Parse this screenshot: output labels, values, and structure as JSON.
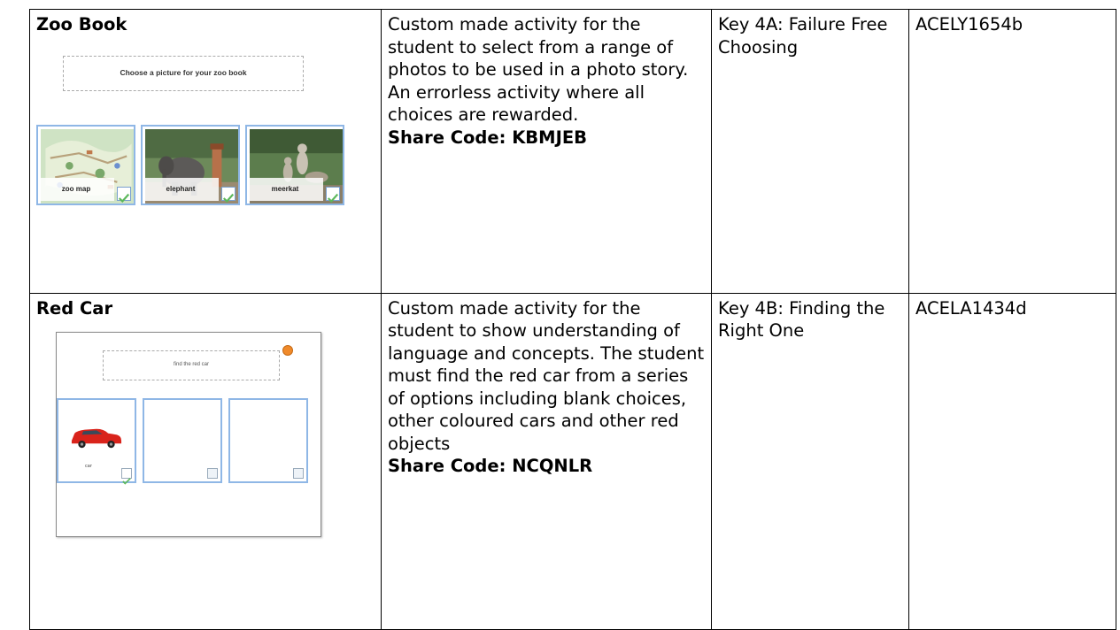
{
  "rows": [
    {
      "title": "Zoo Book",
      "description": "Custom made activity for the student to select from a range of photos to be used in a photo story. An errorless activity where all choices are rewarded.",
      "share_code": "Share Code: KBMJEB",
      "key": "Key 4A: Failure Free Choosing",
      "code": "ACELY1654b",
      "thumbnail": {
        "banner": "Choose a picture for your zoo book",
        "cards": [
          {
            "label": "zoo map"
          },
          {
            "label": "elephant"
          },
          {
            "label": "meerkat"
          }
        ]
      }
    },
    {
      "title": "Red Car",
      "description": "Custom made activity for the student to show understanding of language and concepts. The student must find the red car from a series of options including blank choices, other coloured cars and other red objects",
      "share_code": "Share Code: NCQNLR",
      "key": "Key 4B: Finding the Right One",
      "code": "ACELA1434d",
      "thumbnail": {
        "banner": "find the red car",
        "cards": [
          {
            "label": "car"
          },
          {
            "label": ""
          },
          {
            "label": ""
          }
        ]
      }
    }
  ],
  "colors": {
    "border": "#000000",
    "card_border": "#8fb7e6",
    "check_green": "#5cb85c",
    "car_red": "#d9231b",
    "dot_orange": "#f08a2a"
  }
}
